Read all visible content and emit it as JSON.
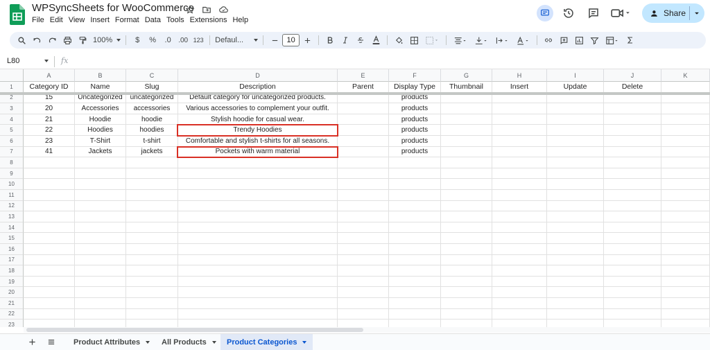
{
  "app": {
    "doc_title": "WPSyncSheets for WooCommerce",
    "menu": [
      "File",
      "Edit",
      "View",
      "Insert",
      "Format",
      "Data",
      "Tools",
      "Extensions",
      "Help"
    ],
    "share_label": "Share",
    "colors": {
      "accent": "#0b57d0",
      "share_bg": "#c2e7ff",
      "highlight": "#d93025",
      "toolbar_bg": "#edf2fa",
      "logo_green": "#0f9d58"
    }
  },
  "toolbar": {
    "zoom": "100%",
    "currency": "$",
    "percent": "%",
    "decimal_decrease": ".0",
    "decimal_increase": ".00",
    "number_format": "123",
    "font": "Defaul...",
    "font_size": "10"
  },
  "formula_bar": {
    "cell_ref": "L80",
    "fx": "fx",
    "value": ""
  },
  "sheet": {
    "columns": [
      "A",
      "B",
      "C",
      "D",
      "E",
      "F",
      "G",
      "H",
      "I",
      "J",
      "K"
    ],
    "row_numbers": [
      "1",
      "2",
      "3",
      "4",
      "5",
      "6",
      "7",
      "8",
      "9",
      "10",
      "11",
      "12",
      "13",
      "14",
      "15",
      "16",
      "17",
      "18",
      "19",
      "20",
      "21",
      "22",
      "23"
    ],
    "header_row": [
      "Category ID",
      "Name",
      "Slug",
      "Description",
      "Parent",
      "Display Type",
      "Thumbnail",
      "Insert",
      "Update",
      "Delete",
      ""
    ],
    "rows": [
      [
        "15",
        "Uncategorized",
        "uncategorized",
        "Default category for uncategorized products.",
        "",
        "products",
        "",
        "",
        "",
        "",
        ""
      ],
      [
        "20",
        "Accessories",
        "accessories",
        "Various accessories to complement your outfit.",
        "",
        "products",
        "",
        "",
        "",
        "",
        ""
      ],
      [
        "21",
        "Hoodie",
        "hoodie",
        "Stylish hoodie for casual wear.",
        "",
        "products",
        "",
        "",
        "",
        "",
        ""
      ],
      [
        "22",
        "Hoodies",
        "hoodies",
        "Trendy Hoodies",
        "",
        "products",
        "",
        "",
        "",
        "",
        ""
      ],
      [
        "23",
        "T-Shirt",
        "t-shirt",
        "Comfortable and stylish t-shirts for all seasons.",
        "",
        "products",
        "",
        "",
        "",
        "",
        ""
      ],
      [
        "41",
        "Jackets",
        "jackets",
        "Pockets with warm material",
        "",
        "products",
        "",
        "",
        "",
        "",
        ""
      ]
    ],
    "highlighted_cells": [
      "D5",
      "D7"
    ]
  },
  "tabs": [
    {
      "label": "Product Attributes",
      "active": false
    },
    {
      "label": "All Products",
      "active": false
    },
    {
      "label": "Product Categories",
      "active": true
    }
  ]
}
